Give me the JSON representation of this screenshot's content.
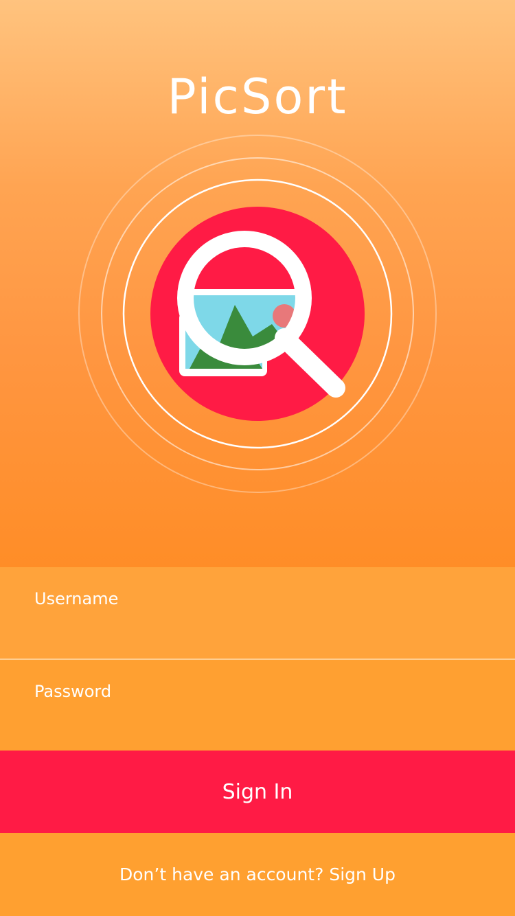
{
  "app": {
    "title": "PicSort",
    "logo_icon": "magnifier-over-picture-icon"
  },
  "form": {
    "username_placeholder": "Username",
    "password_placeholder": "Password",
    "signin_label": "Sign In"
  },
  "footer": {
    "prompt": "Don’t have an account?",
    "signup_label": "Sign Up"
  },
  "colors": {
    "accent": "#ff1b45",
    "orange": "#ffa031",
    "hero_top": "#ffc37e",
    "hero_bottom": "#ff8d27"
  }
}
